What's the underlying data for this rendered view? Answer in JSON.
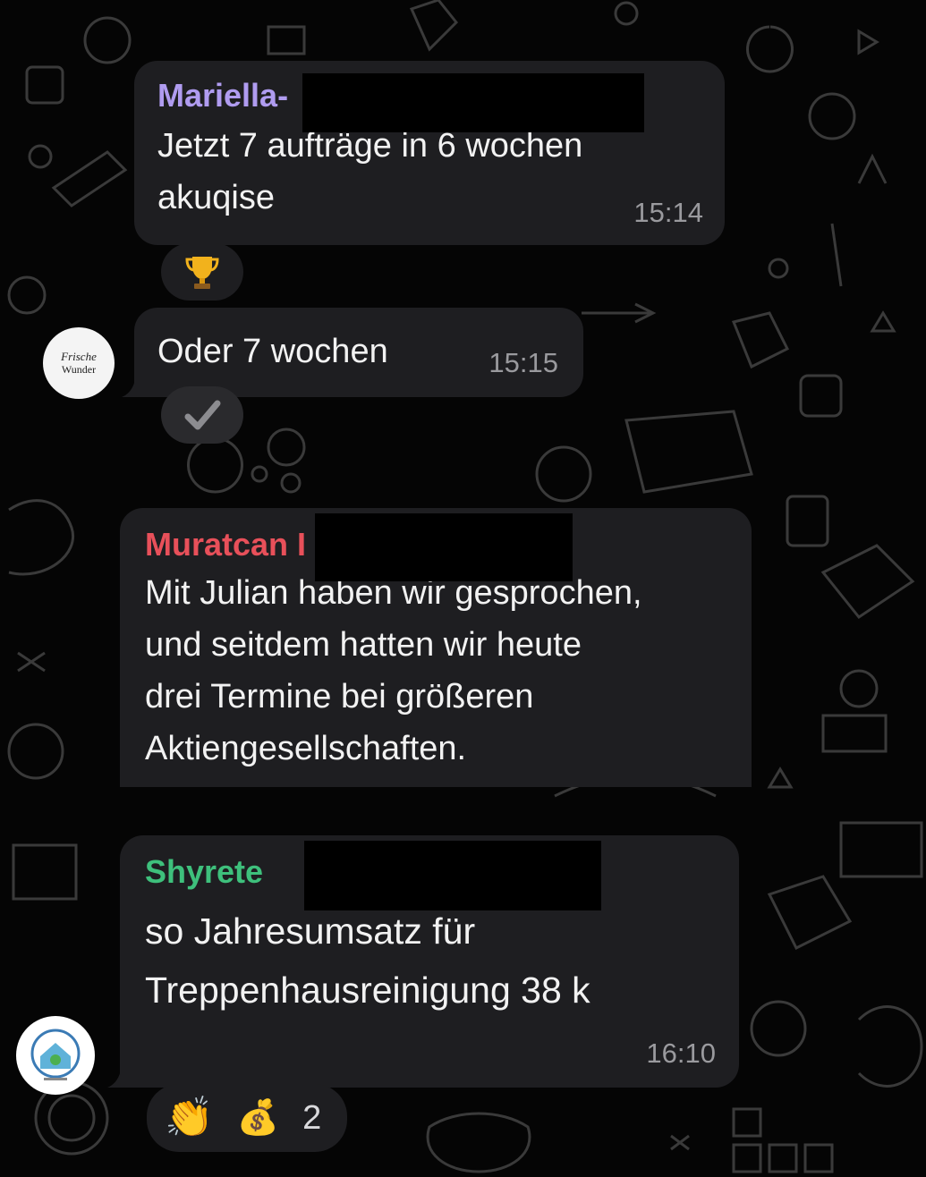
{
  "messages": [
    {
      "sender": "Mariella-",
      "sender_color": "#b09cf0",
      "text_lines": [
        "Jetzt 7 aufträge in 6 wochen",
        "akuqise"
      ],
      "time": "15:14",
      "reaction_icon": "trophy-icon"
    },
    {
      "text_lines": [
        "Oder 7 wochen"
      ],
      "time": "15:15",
      "reaction_icon": "check-icon",
      "avatar_text": [
        "Frische",
        "Wunder"
      ]
    },
    {
      "sender": "Muratcan I",
      "sender_color": "#e8505a",
      "text_lines": [
        "Mit Julian haben wir gesprochen,",
        "und seitdem hatten wir heute",
        "drei Termine bei größeren",
        "Aktiengesellschaften."
      ]
    },
    {
      "sender": "Shyrete",
      "sender_color": "#3ec07c",
      "text_lines": [
        "so Jahresumsatz für",
        "Treppenhausreinigung 38 k"
      ],
      "time": "16:10",
      "reactions": [
        {
          "icon": "clapping-hands-icon",
          "glyph": "👏"
        },
        {
          "icon": "money-bag-icon",
          "glyph": "💰"
        }
      ],
      "reaction_count": "2"
    }
  ]
}
